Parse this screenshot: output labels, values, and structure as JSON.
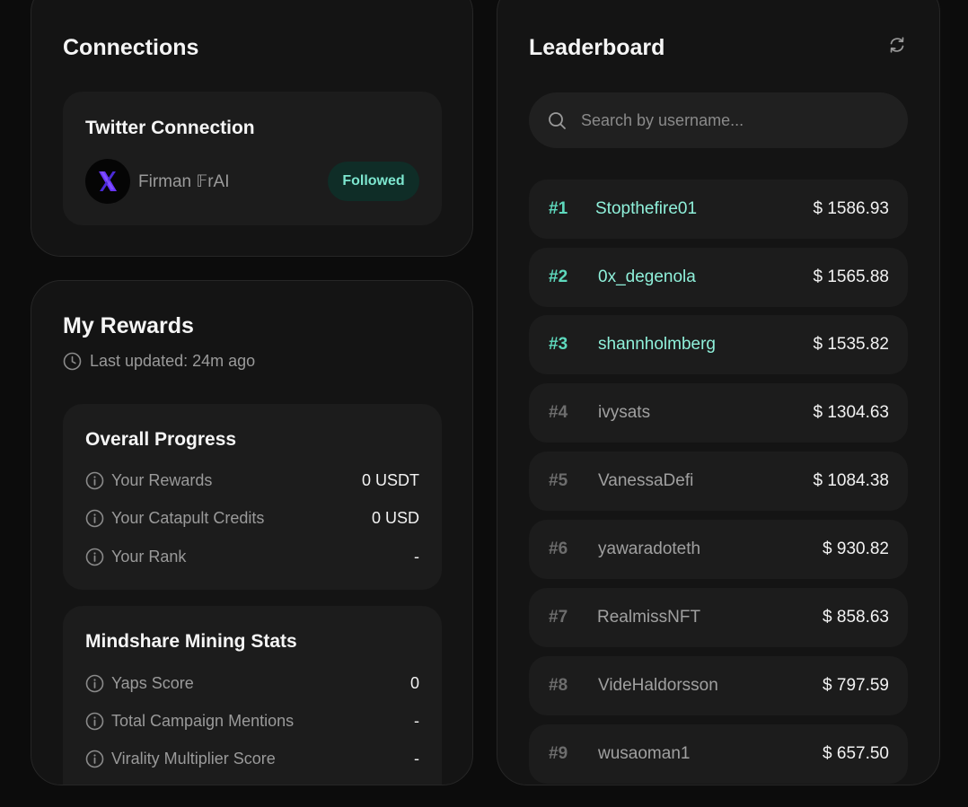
{
  "connections": {
    "title": "Connections",
    "twitter": {
      "title": "Twitter Connection",
      "user_name": "Firman 𝔽rAI",
      "status_label": "Followed"
    }
  },
  "rewards": {
    "title": "My Rewards",
    "last_updated": "Last updated: 24m ago",
    "overall": {
      "title": "Overall Progress",
      "rows": [
        {
          "label": "Your Rewards",
          "value": "0 USDT"
        },
        {
          "label": "Your Catapult Credits",
          "value": "0 USD"
        },
        {
          "label": "Your Rank",
          "value": "-"
        }
      ]
    },
    "mindshare": {
      "title": "Mindshare Mining Stats",
      "rows": [
        {
          "label": "Yaps Score",
          "value": "0"
        },
        {
          "label": "Total Campaign Mentions",
          "value": "-"
        },
        {
          "label": "Virality Multiplier Score",
          "value": "-"
        }
      ]
    }
  },
  "leaderboard": {
    "title": "Leaderboard",
    "search_placeholder": "Search by username...",
    "rows": [
      {
        "rank": "#1",
        "user": "Stopthefire01",
        "score": "$ 1586.93"
      },
      {
        "rank": "#2",
        "user": "0x_degenola",
        "score": "$ 1565.88"
      },
      {
        "rank": "#3",
        "user": "shannholmberg",
        "score": "$ 1535.82"
      },
      {
        "rank": "#4",
        "user": "ivysats",
        "score": "$ 1304.63"
      },
      {
        "rank": "#5",
        "user": "VanessaDefi",
        "score": "$ 1084.38"
      },
      {
        "rank": "#6",
        "user": "yawaradoteth",
        "score": "$ 930.82"
      },
      {
        "rank": "#7",
        "user": "RealmissNFT",
        "score": "$ 858.63"
      },
      {
        "rank": "#8",
        "user": "VideHaldorsson",
        "score": "$ 797.59"
      },
      {
        "rank": "#9",
        "user": "wusaoman1",
        "score": "$ 657.50"
      }
    ]
  },
  "colors": {
    "accent": "#5ed9bd",
    "background": "#0c0c0c",
    "panel": "#141414",
    "card": "#1c1c1c"
  },
  "icons": {
    "refresh": "refresh-icon",
    "search": "search-icon",
    "clock": "clock-icon",
    "info": "info-icon",
    "avatar_logo": "x-logo-icon"
  }
}
